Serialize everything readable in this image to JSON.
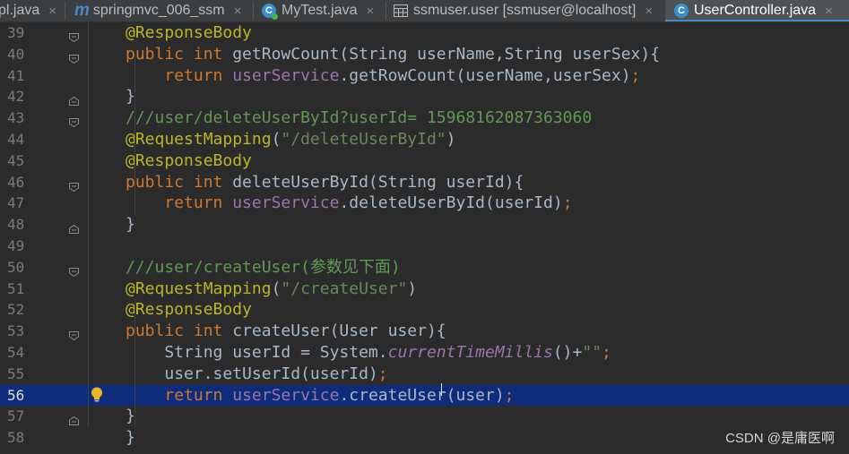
{
  "tabs": [
    {
      "label": "pl.java",
      "icon": "java-file-icon",
      "active": false
    },
    {
      "label": "springmvc_006_ssm",
      "icon": "maven-module-icon",
      "active": false
    },
    {
      "label": "MyTest.java",
      "icon": "java-class-icon",
      "active": false
    },
    {
      "label": "ssmuser.user [ssmuser@localhost]",
      "icon": "database-table-icon",
      "active": false
    },
    {
      "label": "UserController.java",
      "icon": "java-class-icon",
      "active": true
    }
  ],
  "tab_close_glyph": "×",
  "current_line": 56,
  "colors": {
    "background": "#2b2b2b",
    "current_line_highlight": "#0e2c7a",
    "keyword": "#cc7832",
    "annotation": "#bbb529",
    "string": "#6a8759",
    "field": "#9876aa",
    "comment": "#629755",
    "default_text": "#a9b7c6"
  },
  "code_lines": [
    {
      "number": "39",
      "indent": "",
      "tokens": [
        {
          "t": "@ResponseBody",
          "c": "ann"
        }
      ]
    },
    {
      "number": "40",
      "indent": "",
      "tokens": [
        {
          "t": "public int ",
          "c": "kw"
        },
        {
          "t": "getRowCount(String userName,String userSex){",
          "c": ""
        }
      ]
    },
    {
      "number": "41",
      "indent": "    ",
      "tokens": [
        {
          "t": "return ",
          "c": "kw"
        },
        {
          "t": "userService",
          "c": "fld"
        },
        {
          "t": ".getRowCount(userName,userSex)",
          "c": ""
        },
        {
          "t": ";",
          "c": "kw"
        }
      ]
    },
    {
      "number": "42",
      "indent": "",
      "tokens": [
        {
          "t": "}",
          "c": ""
        }
      ]
    },
    {
      "number": "43",
      "indent": "",
      "tokens": [
        {
          "t": "///user/deleteUserById?userId= 15968162087363060",
          "c": "cm"
        }
      ]
    },
    {
      "number": "44",
      "indent": "",
      "tokens": [
        {
          "t": "@RequestMapping",
          "c": "ann"
        },
        {
          "t": "(",
          "c": ""
        },
        {
          "t": "\"/deleteUserById\"",
          "c": "str"
        },
        {
          "t": ")",
          "c": ""
        }
      ]
    },
    {
      "number": "45",
      "indent": "",
      "tokens": [
        {
          "t": "@ResponseBody",
          "c": "ann"
        }
      ]
    },
    {
      "number": "46",
      "indent": "",
      "tokens": [
        {
          "t": "public int ",
          "c": "kw"
        },
        {
          "t": "deleteUserById(String userId){",
          "c": ""
        }
      ]
    },
    {
      "number": "47",
      "indent": "    ",
      "tokens": [
        {
          "t": "return ",
          "c": "kw"
        },
        {
          "t": "userService",
          "c": "fld"
        },
        {
          "t": ".deleteUserById(userId)",
          "c": ""
        },
        {
          "t": ";",
          "c": "kw"
        }
      ]
    },
    {
      "number": "48",
      "indent": "",
      "tokens": [
        {
          "t": "}",
          "c": ""
        }
      ]
    },
    {
      "number": "49",
      "indent": "",
      "tokens": []
    },
    {
      "number": "50",
      "indent": "",
      "tokens": [
        {
          "t": "///user/createUser(参数见下面)",
          "c": "cm"
        }
      ]
    },
    {
      "number": "51",
      "indent": "",
      "tokens": [
        {
          "t": "@RequestMapping",
          "c": "ann"
        },
        {
          "t": "(",
          "c": ""
        },
        {
          "t": "\"/createUser\"",
          "c": "str"
        },
        {
          "t": ")",
          "c": ""
        }
      ]
    },
    {
      "number": "52",
      "indent": "",
      "tokens": [
        {
          "t": "@ResponseBody",
          "c": "ann"
        }
      ]
    },
    {
      "number": "53",
      "indent": "",
      "tokens": [
        {
          "t": "public int ",
          "c": "kw"
        },
        {
          "t": "createUser(User user){",
          "c": ""
        }
      ]
    },
    {
      "number": "54",
      "indent": "    ",
      "tokens": [
        {
          "t": "String userId = System.",
          "c": ""
        },
        {
          "t": "currentTimeMillis",
          "c": "st"
        },
        {
          "t": "()+",
          "c": ""
        },
        {
          "t": "\"\"",
          "c": "str"
        },
        {
          "t": ";",
          "c": "kw"
        }
      ]
    },
    {
      "number": "55",
      "indent": "    ",
      "tokens": [
        {
          "t": "user.setUserId(userId)",
          "c": ""
        },
        {
          "t": ";",
          "c": "kw"
        }
      ]
    },
    {
      "number": "56",
      "indent": "    ",
      "tokens": [
        {
          "t": "return ",
          "c": "kw"
        },
        {
          "t": "userService",
          "c": "fld"
        },
        {
          "t": ".createUser(user)",
          "c": ""
        },
        {
          "t": ";",
          "c": "kw"
        }
      ]
    },
    {
      "number": "57",
      "indent": "",
      "tokens": [
        {
          "t": "}",
          "c": ""
        }
      ]
    },
    {
      "number": "58",
      "indent": "",
      "tokens": [
        {
          "t": "}",
          "c": ""
        }
      ]
    }
  ],
  "fold_markers": [
    {
      "line": "39",
      "kind": "open"
    },
    {
      "line": "40",
      "kind": "open"
    },
    {
      "line": "42",
      "kind": "close"
    },
    {
      "line": "43",
      "kind": "open"
    },
    {
      "line": "46",
      "kind": "open"
    },
    {
      "line": "48",
      "kind": "close"
    },
    {
      "line": "50",
      "kind": "open"
    },
    {
      "line": "53",
      "kind": "open"
    },
    {
      "line": "57",
      "kind": "close"
    }
  ],
  "intention_bulb_line": "56",
  "watermark": "CSDN @是庸医啊"
}
